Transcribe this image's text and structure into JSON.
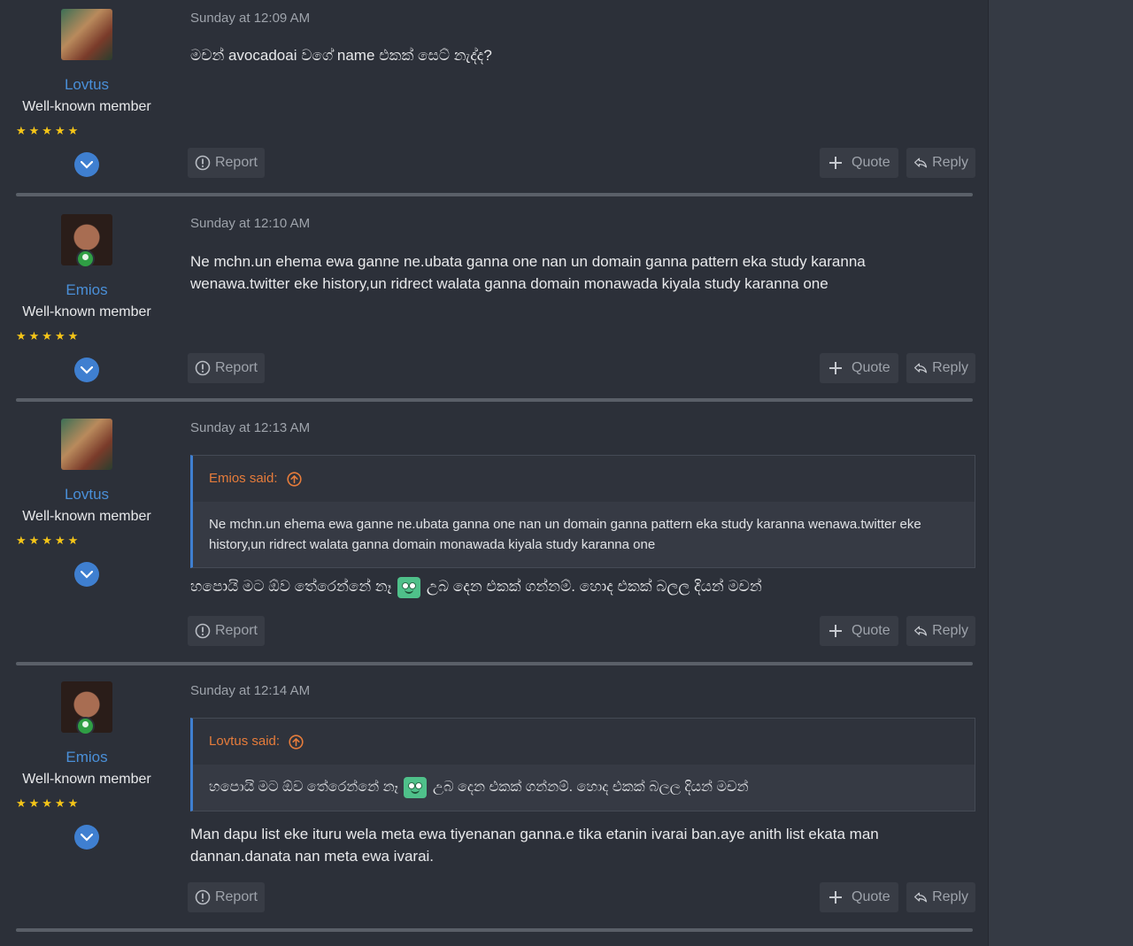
{
  "colors": {
    "background": "#2c3039",
    "username": "#4a8fd8",
    "stars": "#f5c518",
    "quote_author": "#e67c3b",
    "quote_border": "#3f7fd0",
    "button_bg": "#383c45"
  },
  "actions": {
    "report_label": "Report",
    "quote_label": "Quote",
    "reply_label": "Reply"
  },
  "posts": [
    {
      "author": "Lovtus",
      "user_title": "Well-known member",
      "stars": "★★★★★",
      "timestamp": "Sunday at 12:09 AM",
      "message": "මචන් avocadoai වගේ name එකක් සෙට් නැද්ද?"
    },
    {
      "author": "Emios",
      "user_title": "Well-known member",
      "stars": "★★★★★",
      "timestamp": "Sunday at 12:10 AM",
      "message": "Ne mchn.un ehema ewa ganne ne.ubata ganna one nan un domain ganna pattern eka study karanna wenawa.twitter eke history,un ridrect walata ganna domain monawada kiyala study karanna one"
    },
    {
      "author": "Lovtus",
      "user_title": "Well-known member",
      "stars": "★★★★★",
      "timestamp": "Sunday at 12:13 AM",
      "quote": {
        "author_said": "Emios said:",
        "text": "Ne mchn.un ehema ewa ganne ne.ubata ganna one nan un domain ganna pattern eka study karanna wenawa.twitter eke history,un ridrect walata ganna domain monawada kiyala study karanna one"
      },
      "message_part1": "හපොයි මට ඕව තේරෙන්නේ නෑ",
      "message_part2": "උබ දෙන එකක් ගන්නම්. හොද එකක් බලල දියන් මචන්"
    },
    {
      "author": "Emios",
      "user_title": "Well-known member",
      "stars": "★★★★★",
      "timestamp": "Sunday at 12:14 AM",
      "quote": {
        "author_said": "Lovtus said:",
        "text_part1": "හපොයි මට ඕව තේරෙන්නේ නෑ",
        "text_part2": "උබ දෙන එකක් ගන්නම්. හොද එකක් බලල දියන් මචන්"
      },
      "message": "Man dapu list eke ituru wela meta ewa tiyenanan ganna.e tika etanin ivarai ban.aye anith list ekata man dannan.danata nan meta ewa ivarai."
    }
  ]
}
